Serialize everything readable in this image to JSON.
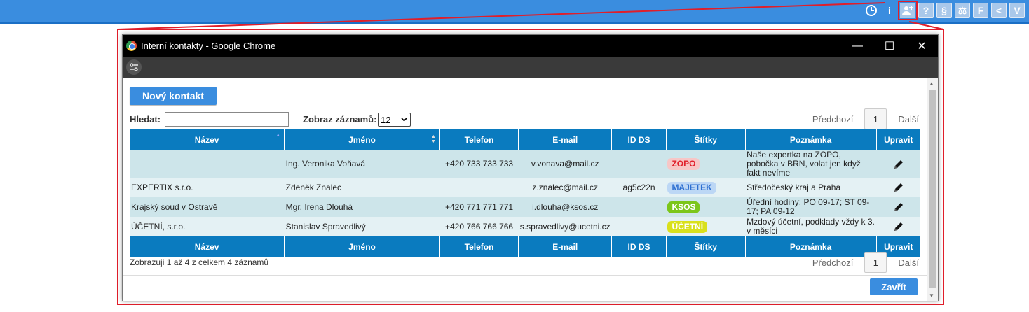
{
  "topbar": {
    "icons": [
      "clock-icon",
      "info-icon",
      "add-contact-icon",
      "help-icon",
      "paragraph-icon",
      "scales-icon",
      "f-icon",
      "back-icon",
      "v-icon"
    ],
    "labels": {
      "help": "?",
      "paragraph": "§",
      "scales": "⚖",
      "f": "F",
      "back": "<",
      "v": "V",
      "info": "i"
    }
  },
  "window": {
    "title": "Interní kontakty - Google Chrome",
    "controls": {
      "minimize": "—",
      "maximize": "☐",
      "close": "✕"
    }
  },
  "toolbar": {
    "new_contact": "Nový kontakt"
  },
  "filters": {
    "search_label": "Hledat:",
    "search_value": "",
    "show_label": "Zobraz záznamů:",
    "show_value": "12"
  },
  "pager": {
    "prev": "Předchozí",
    "page": "1",
    "next": "Další"
  },
  "table": {
    "headers": [
      "Název",
      "Jméno",
      "Telefon",
      "E-mail",
      "ID DS",
      "Štítky",
      "Poznámka",
      "Upravit"
    ],
    "rows": [
      {
        "name": "",
        "person": "Ing. Veronika Voňavá",
        "phone": "+420 733 733 733",
        "email": "v.vonava@mail.cz",
        "ids": "",
        "tag": "ZOPO",
        "tag_bg": "#f7c6c6",
        "tag_fg": "#e01e2a",
        "note": "Naše expertka na ZOPO, pobočka v BRN, volat jen když fakt nevíme"
      },
      {
        "name": "EXPERTIX s.r.o.",
        "person": "Zdeněk Znalec",
        "phone": "",
        "email": "z.znalec@mail.cz",
        "ids": "ag5c22n",
        "tag": "MAJETEK",
        "tag_bg": "#bcd7f5",
        "tag_fg": "#2c6fd0",
        "note": "Středočeský kraj a Praha"
      },
      {
        "name": "Krajský soud v Ostravě",
        "person": "Mgr. Irena Dlouhá",
        "phone": "+420 771 771 771",
        "email": "i.dlouha@ksos.cz",
        "ids": "",
        "tag": "KSOS",
        "tag_bg": "#7cc61a",
        "tag_fg": "#ffffff",
        "note": "Úřední hodiny: PO 09-17; ST 09-17; PA 09-12"
      },
      {
        "name": "ÚČETNÍ, s.r.o.",
        "person": "Stanislav Spravedlivý",
        "phone": "+420 766 766 766",
        "email": "s.spravedlivy@ucetni.cz",
        "ids": "",
        "tag": "ÚČETNÍ",
        "tag_bg": "#d9e01c",
        "tag_fg": "#ffffff",
        "note": "Mzdový účetní, podklady vždy k 3. v měsíci"
      }
    ]
  },
  "info_text": "Zobrazuji 1 až 4 z celkem 4 záznamů",
  "close_button": "Zavřít",
  "colors": {
    "accent": "#3a8ddf",
    "header": "#0a7bbf",
    "highlight": "#e01e2a"
  }
}
